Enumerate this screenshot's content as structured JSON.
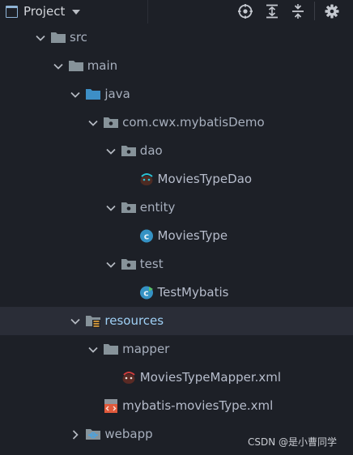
{
  "toolbar": {
    "title": "Project",
    "title_icon": "project-window-icon",
    "actions": [
      {
        "name": "locate-icon"
      },
      {
        "name": "expand-all-icon"
      },
      {
        "name": "collapse-all-icon"
      },
      {
        "name": "gear-icon"
      }
    ]
  },
  "tree": {
    "nodes": [
      {
        "label": "src",
        "depth": 0,
        "expanded": true,
        "icon": "folder-icon"
      },
      {
        "label": "main",
        "depth": 1,
        "expanded": true,
        "icon": "folder-icon"
      },
      {
        "label": "java",
        "depth": 2,
        "expanded": true,
        "icon": "source-root-folder-icon"
      },
      {
        "label": "com.cwx.mybatisDemo",
        "depth": 3,
        "expanded": true,
        "icon": "package-icon"
      },
      {
        "label": "dao",
        "depth": 4,
        "expanded": true,
        "icon": "package-icon"
      },
      {
        "label": "MoviesTypeDao",
        "depth": 5,
        "leaf": true,
        "icon": "mybatis-interface-icon"
      },
      {
        "label": "entity",
        "depth": 4,
        "expanded": true,
        "icon": "package-icon"
      },
      {
        "label": "MoviesType",
        "depth": 5,
        "leaf": true,
        "icon": "class-icon"
      },
      {
        "label": "test",
        "depth": 4,
        "expanded": true,
        "icon": "package-icon"
      },
      {
        "label": "TestMybatis",
        "depth": 5,
        "leaf": true,
        "icon": "runnable-class-icon"
      },
      {
        "label": "resources",
        "depth": 2,
        "expanded": true,
        "icon": "resources-root-folder-icon",
        "selected": true
      },
      {
        "label": "mapper",
        "depth": 3,
        "expanded": true,
        "icon": "folder-icon"
      },
      {
        "label": "MoviesTypeMapper.xml",
        "depth": 4,
        "leaf": true,
        "icon": "mybatis-mapper-xml-icon"
      },
      {
        "label": "mybatis-moviesType.xml",
        "depth": 3,
        "leaf": true,
        "icon": "xml-file-icon"
      },
      {
        "label": "webapp",
        "depth": 2,
        "expanded": false,
        "icon": "web-folder-icon"
      }
    ]
  },
  "watermark": "CSDN @是小曹同学",
  "colors": {
    "background": "#1d2027",
    "selected_row": "#2a2d37",
    "folder": "#87939a",
    "source_folder": "#3d8fc6",
    "class_icon": "#3592c4",
    "xml_icon": "#e15a3c",
    "label_text": "#a7afbd",
    "selected_text": "#9fd0f5"
  }
}
